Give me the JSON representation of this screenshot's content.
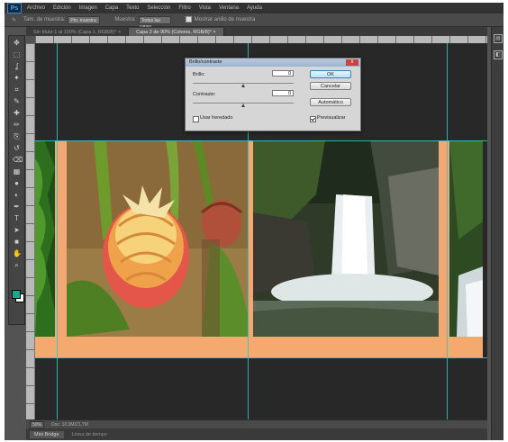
{
  "app": {
    "logo": "Ps"
  },
  "menu": [
    "Archivo",
    "Edición",
    "Imagen",
    "Capa",
    "Texto",
    "Selección",
    "Filtro",
    "Vista",
    "Ventana",
    "Ayuda"
  ],
  "options": {
    "sample_label": "Tam. de muestra:",
    "sample_value": "Pto. muestra",
    "sample2_label": "Muestra:",
    "sample2_value": "Todas las capas",
    "ring_label": "Mostrar anillo de muestra"
  },
  "tabs": [
    {
      "label": "Sin título-1 al 100% (Capa 1, RGB/8)*",
      "active": false
    },
    {
      "label": "Capa 2 de 90% (Colores, RGB/8)*",
      "active": true
    }
  ],
  "dialog": {
    "title": "Brillo/contraste",
    "close": "x",
    "brightness_label": "Brillo:",
    "brightness_value": "0",
    "contrast_label": "Contraste:",
    "contrast_value": "0",
    "legacy_label": "Usar heredado",
    "preview_label": "Previsualizar",
    "ok_label": "OK",
    "cancel_label": "Cancelar",
    "auto_label": "Automático",
    "legacy_checked": false,
    "preview_checked": true,
    "brightness_pos": 0.5,
    "contrast_pos": 0.5
  },
  "status": {
    "zoom": "50%",
    "info": "Doc: 10,0M/21,7M"
  },
  "bottom_tabs": [
    {
      "label": "Mini Bridge",
      "active": true
    },
    {
      "label": "Línea de tiempo",
      "active": false
    }
  ],
  "colors": {
    "guide": "#2fc7c2",
    "frame": "#f2a874",
    "foreground": "#1ba88e",
    "background": "#ffffff"
  },
  "toolbox": [
    "move-icon",
    "marquee-icon",
    "lasso-icon",
    "quick-select-icon",
    "crop-icon",
    "eyedropper-icon",
    "healing-icon",
    "brush-icon",
    "stamp-icon",
    "history-brush-icon",
    "eraser-icon",
    "gradient-icon",
    "blur-icon",
    "dodge-icon",
    "pen-icon",
    "type-icon",
    "path-select-icon",
    "shape-icon",
    "hand-icon",
    "zoom-icon"
  ]
}
